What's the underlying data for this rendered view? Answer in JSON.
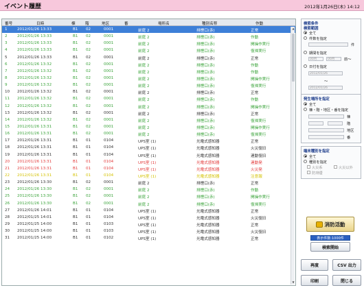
{
  "window": {
    "title": "イベント履歴",
    "datetime": "2012年1月26日(木) 14:12"
  },
  "table": {
    "headers": [
      "番号",
      "日時",
      "棟",
      "階",
      "地区",
      "番",
      "場所名",
      "種別名称",
      "作動"
    ],
    "rows": [
      {
        "no": "1",
        "datetime": "2012/01/26 13:33",
        "bldg": "B1",
        "floor": "02",
        "area": "0001",
        "id": "",
        "place": "前庭 2",
        "type": "排煙口(赤)",
        "action": "正常",
        "color": "selected"
      },
      {
        "no": "2",
        "datetime": "2012/01/26 13:33",
        "bldg": "B1",
        "floor": "02",
        "area": "0001",
        "id": "",
        "place": "前庭 2",
        "type": "排煙口(赤)",
        "action": "作動",
        "color": "green"
      },
      {
        "no": "3",
        "datetime": "2012/01/26 13:33",
        "bldg": "B1",
        "floor": "02",
        "area": "0001",
        "id": "",
        "place": "前庭 2",
        "type": "排煙口(赤)",
        "action": "開操作実行",
        "color": "green"
      },
      {
        "no": "4",
        "datetime": "2012/01/26 13:33",
        "bldg": "B1",
        "floor": "02",
        "area": "0001",
        "id": "",
        "place": "前庭 2",
        "type": "排煙口(赤)",
        "action": "復帰実行",
        "color": "green"
      },
      {
        "no": "5",
        "datetime": "2012/01/26 13:33",
        "bldg": "B1",
        "floor": "02",
        "area": "0001",
        "id": "",
        "place": "前庭 2",
        "type": "排煙口(赤)",
        "action": "正常",
        "color": "normal"
      },
      {
        "no": "6",
        "datetime": "2012/01/26 13:32",
        "bldg": "B1",
        "floor": "02",
        "area": "0001",
        "id": "",
        "place": "前庭 2",
        "type": "排煙口(赤)",
        "action": "作動",
        "color": "green"
      },
      {
        "no": "7",
        "datetime": "2012/01/26 13:32",
        "bldg": "B1",
        "floor": "02",
        "area": "0001",
        "id": "",
        "place": "前庭 2",
        "type": "排煙口(赤)",
        "action": "作動",
        "color": "green"
      },
      {
        "no": "8",
        "datetime": "2012/01/26 13:32",
        "bldg": "B1",
        "floor": "02",
        "area": "0001",
        "id": "",
        "place": "前庭 2",
        "type": "排煙口(赤)",
        "action": "開操作実行",
        "color": "green"
      },
      {
        "no": "9",
        "datetime": "2012/01/26 13:32",
        "bldg": "B1",
        "floor": "02",
        "area": "0001",
        "id": "",
        "place": "前庭 2",
        "type": "排煙口(赤)",
        "action": "復帰実行",
        "color": "green"
      },
      {
        "no": "10",
        "datetime": "2012/01/26 13:32",
        "bldg": "B1",
        "floor": "02",
        "area": "0001",
        "id": "",
        "place": "前庭 2",
        "type": "排煙口(赤)",
        "action": "正常",
        "color": "normal"
      },
      {
        "no": "11",
        "datetime": "2012/01/26 13:32",
        "bldg": "B1",
        "floor": "02",
        "area": "0001",
        "id": "",
        "place": "前庭 2",
        "type": "排煙口(赤)",
        "action": "作動",
        "color": "green"
      },
      {
        "no": "12",
        "datetime": "2012/01/26 13:32",
        "bldg": "B1",
        "floor": "02",
        "area": "0001",
        "id": "",
        "place": "前庭 2",
        "type": "排煙口(赤)",
        "action": "開操作実行",
        "color": "green"
      },
      {
        "no": "13",
        "datetime": "2012/01/26 13:32",
        "bldg": "B1",
        "floor": "02",
        "area": "0001",
        "id": "",
        "place": "前庭 2",
        "type": "排煙口(赤)",
        "action": "正常",
        "color": "normal"
      },
      {
        "no": "14",
        "datetime": "2012/01/26 13:32",
        "bldg": "B1",
        "floor": "02",
        "area": "0001",
        "id": "",
        "place": "前庭 2",
        "type": "排煙口(赤)",
        "action": "復帰実行",
        "color": "green"
      },
      {
        "no": "15",
        "datetime": "2012/01/26 13:31",
        "bldg": "B1",
        "floor": "02",
        "area": "0001",
        "id": "",
        "place": "前庭 2",
        "type": "排煙口(赤)",
        "action": "開操作実行",
        "color": "green"
      },
      {
        "no": "16",
        "datetime": "2012/01/26 13:31",
        "bldg": "B1",
        "floor": "02",
        "area": "0001",
        "id": "",
        "place": "前庭 2",
        "type": "排煙口(赤)",
        "action": "復帰実行",
        "color": "green"
      },
      {
        "no": "17",
        "datetime": "2012/01/26 13:31",
        "bldg": "B1",
        "floor": "01",
        "area": "0104",
        "id": "",
        "place": "UPS室 (1)",
        "type": "光電式感知器",
        "action": "正常",
        "color": "normal"
      },
      {
        "no": "18",
        "datetime": "2012/01/26 13:31",
        "bldg": "B1",
        "floor": "01",
        "area": "0104",
        "id": "",
        "place": "UPS室 (1)",
        "type": "光電式感知器",
        "action": "火災復旧",
        "color": "normal"
      },
      {
        "no": "19",
        "datetime": "2012/01/26 13:31",
        "bldg": "B1",
        "floor": "01",
        "area": "0104",
        "id": "",
        "place": "UPS室 (1)",
        "type": "光電式感知器",
        "action": "連動復旧",
        "color": "normal"
      },
      {
        "no": "20",
        "datetime": "2012/01/26 13:31",
        "bldg": "B1",
        "floor": "01",
        "area": "0104",
        "id": "",
        "place": "UPS室 (1)",
        "type": "光電式感知器",
        "action": "連動発",
        "color": "red"
      },
      {
        "no": "21",
        "datetime": "2012/01/26 13:31",
        "bldg": "B1",
        "floor": "01",
        "area": "0104",
        "id": "",
        "place": "UPS室 (1)",
        "type": "光電式感知器",
        "action": "火災発",
        "color": "red"
      },
      {
        "no": "22",
        "datetime": "2012/01/26 13:31",
        "bldg": "B1",
        "floor": "01",
        "area": "0104",
        "id": "",
        "place": "UPS室 (1)",
        "type": "光電式感知器",
        "action": "注意報",
        "color": "yellow"
      },
      {
        "no": "23",
        "datetime": "2012/01/26 13:30",
        "bldg": "B1",
        "floor": "02",
        "area": "0001",
        "id": "",
        "place": "前庭 2",
        "type": "排煙口(赤)",
        "action": "正常",
        "color": "normal"
      },
      {
        "no": "24",
        "datetime": "2012/01/26 13:30",
        "bldg": "B1",
        "floor": "02",
        "area": "0001",
        "id": "",
        "place": "前庭 2",
        "type": "排煙口(赤)",
        "action": "作動",
        "color": "green"
      },
      {
        "no": "25",
        "datetime": "2012/01/26 13:30",
        "bldg": "B1",
        "floor": "02",
        "area": "0001",
        "id": "",
        "place": "前庭 2",
        "type": "排煙口(赤)",
        "action": "開操作実行",
        "color": "green"
      },
      {
        "no": "26",
        "datetime": "2012/01/26 13:30",
        "bldg": "B1",
        "floor": "02",
        "area": "0001",
        "id": "",
        "place": "前庭 2",
        "type": "排煙口(赤)",
        "action": "復帰実行",
        "color": "green"
      },
      {
        "no": "27",
        "datetime": "2012/01/26 14:01",
        "bldg": "B1",
        "floor": "01",
        "area": "0104",
        "id": "",
        "place": "UPS室 (1)",
        "type": "光電式感知器",
        "action": "正常",
        "color": "normal"
      },
      {
        "no": "28",
        "datetime": "2012/01/25 14:01",
        "bldg": "B1",
        "floor": "01",
        "area": "0104",
        "id": "",
        "place": "UPS室 (1)",
        "type": "光電式感知器",
        "action": "火災復旧",
        "color": "normal"
      },
      {
        "no": "29",
        "datetime": "2012/01/25 14:00",
        "bldg": "B1",
        "floor": "01",
        "area": "0103",
        "id": "",
        "place": "UPS室 (1)",
        "type": "光電式感知器",
        "action": "正常",
        "color": "normal"
      },
      {
        "no": "30",
        "datetime": "2012/01/25 14:00",
        "bldg": "B1",
        "floor": "01",
        "area": "0103",
        "id": "",
        "place": "UPS室 (1)",
        "type": "光電式感知器",
        "action": "火災復旧",
        "color": "normal"
      },
      {
        "no": "31",
        "datetime": "2012/01/25 14:00",
        "bldg": "B1",
        "floor": "01",
        "area": "0102",
        "id": "",
        "place": "UPS室 (1)",
        "type": "光電式感知器",
        "action": "正常",
        "color": "normal"
      }
    ]
  },
  "panel": {
    "search_title": "検索条件",
    "range_title": "検索範囲",
    "all_label": "全て",
    "count_label": "件数を指定",
    "count_unit": "件",
    "period_label": "期間を指定",
    "period_from": "00月",
    "period_to": "00月",
    "period_suffix": "前～",
    "date_label": "日付を指定",
    "date_from": "2012/01/26",
    "date_tilde": "～",
    "date_to": "2012/01/26",
    "place_title": "発生場所を指定",
    "place_all": "全て",
    "place_spec": "棟・階・地区・番を指定",
    "unit_bldg": "棟",
    "unit_floor": "階",
    "unit_area": "地区",
    "unit_no": "番",
    "term_title": "端末種別を指定",
    "term_all": "全て",
    "term_spec": "種別を指定",
    "term_opt1": "火災系",
    "term_opt2": "火災以外",
    "term_opt3": "防排煙"
  },
  "buttons": {
    "fire": "消防活動",
    "count_badge": "表示件数:1000件",
    "search": "検索開始",
    "redisplay": "再度",
    "csv": "CSV 出力",
    "print": "印刷",
    "close": "閉じる"
  },
  "colors": {
    "title_bg": "#f7c8dc",
    "selected_row": "#3d7fd8",
    "green": "#3aa33a",
    "red": "#e33b3b",
    "yellow": "#d4c200"
  }
}
